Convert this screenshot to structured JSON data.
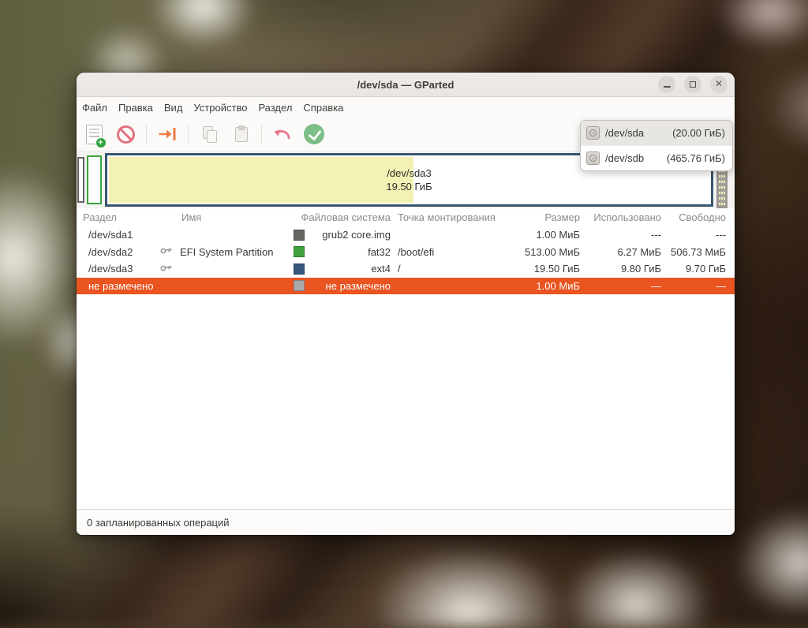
{
  "window": {
    "title": "/dev/sda — GParted",
    "controls": [
      {
        "name": "minimize"
      },
      {
        "name": "maximize"
      },
      {
        "name": "close"
      }
    ]
  },
  "menu": {
    "items": [
      "Файл",
      "Правка",
      "Вид",
      "Устройство",
      "Раздел",
      "Справка"
    ]
  },
  "toolbar": {
    "buttons": [
      {
        "icon": "new-partition-icon",
        "enabled": true
      },
      {
        "icon": "delete-partition-icon",
        "enabled": true
      },
      {
        "icon": "resize-move-icon",
        "enabled": true
      },
      {
        "icon": "copy-partition-icon",
        "enabled": false
      },
      {
        "icon": "paste-partition-icon",
        "enabled": false
      },
      {
        "icon": "undo-icon",
        "enabled": true
      },
      {
        "icon": "apply-operations-icon",
        "enabled": true
      }
    ]
  },
  "device_selector": {
    "items": [
      {
        "icon": "disk-icon",
        "device": "/dev/sda",
        "size": "(20.00 ГиБ)",
        "selected": true
      },
      {
        "icon": "disk-icon",
        "device": "/dev/sdb",
        "size": "(465.76 ГиБ)",
        "selected": false
      }
    ]
  },
  "partition_graphic": {
    "segments": [
      "/dev/sda1",
      "/dev/sda2",
      "/dev/sda3",
      "не размечено"
    ],
    "selected_partition": {
      "label": "/dev/sda3",
      "size": "19.50 ГиБ",
      "used_width": "50.5%"
    }
  },
  "table": {
    "headers": [
      "Раздел",
      "Имя",
      "Файловая система",
      "Точка монтирования",
      "Размер",
      "Использовано",
      "Свободно"
    ],
    "rows": [
      {
        "partition": "/dev/sda1",
        "locked": false,
        "name": "",
        "fs": "grub2 core.img",
        "fs_color": "#66655F",
        "mount": "",
        "size": "1.00 МиБ",
        "used": "---",
        "free": "---",
        "selected": false
      },
      {
        "partition": "/dev/sda2",
        "locked": true,
        "name": "EFI System Partition",
        "fs": "fat32",
        "fs_color": "#41A33F",
        "mount": "/boot/efi",
        "size": "513.00 МиБ",
        "used": "6.27 МиБ",
        "free": "506.73 МиБ",
        "selected": false
      },
      {
        "partition": "/dev/sda3",
        "locked": true,
        "name": "",
        "fs": "ext4",
        "fs_color": "#35587C",
        "mount": "/",
        "size": "19.50 ГиБ",
        "used": "9.80 ГиБ",
        "free": "9.70 ГиБ",
        "selected": false
      },
      {
        "partition": "не размечено",
        "locked": false,
        "name": "",
        "fs": "не размечено",
        "fs_color": "#A9A9A9",
        "mount": "",
        "size": "1.00 МиБ",
        "used": "—",
        "free": "—",
        "selected": true
      }
    ]
  },
  "statusbar": {
    "text": "0 запланированных операций"
  },
  "colors": {
    "selection_orange": "#E95420",
    "used_yellow": "#F3F2B5",
    "ext4_border": "#39566E",
    "fat32_border": "#3BA43B",
    "grub_border": "#636363",
    "unallocated_gray": "#A9A9A9",
    "titlebar_bg": "#EBE8E6"
  }
}
